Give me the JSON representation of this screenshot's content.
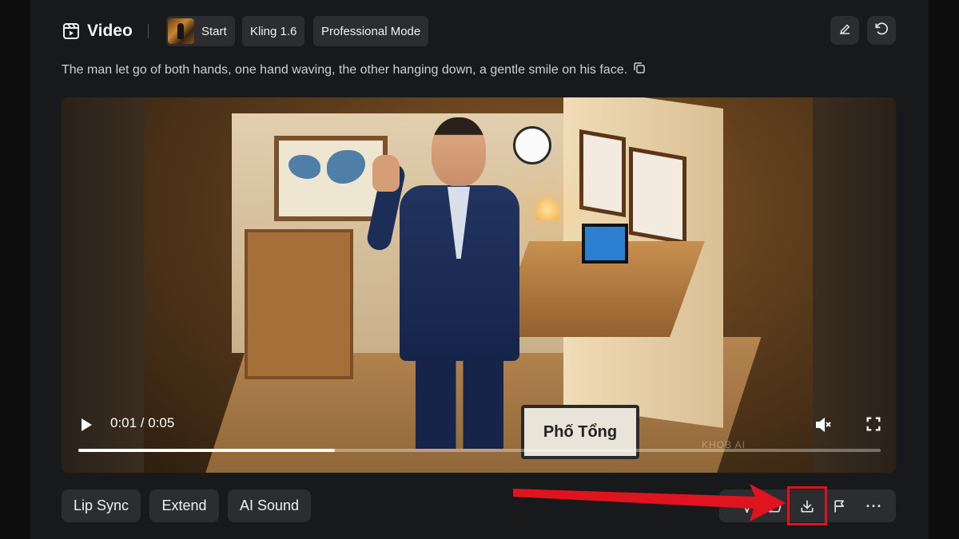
{
  "header": {
    "title": "Video",
    "start_label": "Start",
    "model_label": "Kling 1.6",
    "mode_label": "Professional Mode"
  },
  "prompt": {
    "text": "The man let go of both hands, one hand waving, the other hanging down, a gentle smile on his face."
  },
  "player": {
    "time": "0:01 / 0:05",
    "progress_fraction": 0.32,
    "sign_text": "Phố Tổng",
    "watermark": "KHOB AI"
  },
  "actions": {
    "lip_sync": "Lip Sync",
    "extend": "Extend",
    "ai_sound": "AI Sound"
  },
  "toolbar": {
    "icons": [
      "send-icon",
      "thumbs-up-icon",
      "download-icon",
      "flag-icon",
      "more-icon"
    ],
    "more_glyph": "···"
  },
  "colors": {
    "background": "#0d0d0e",
    "panel": "#18191b",
    "chip": "#2c2d30",
    "annotation_red": "#e0141f"
  }
}
